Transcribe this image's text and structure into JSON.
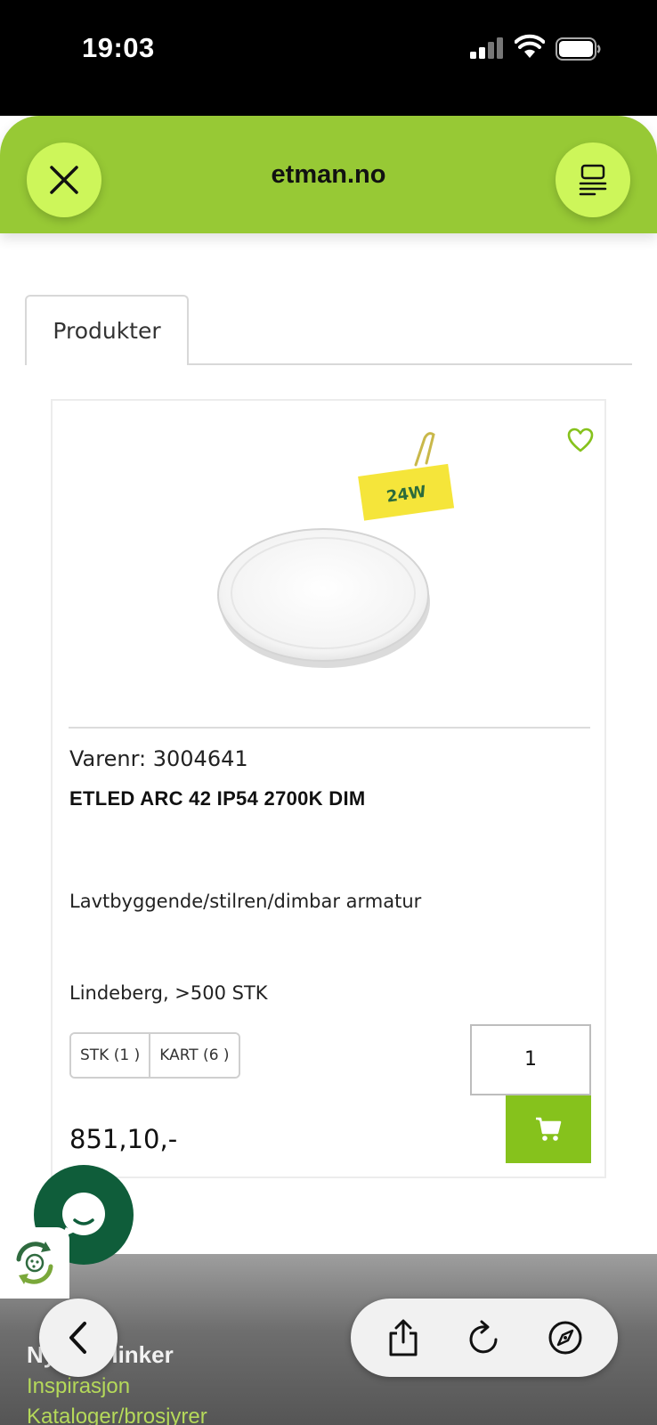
{
  "status_bar": {
    "time": "19:03"
  },
  "header": {
    "site_title": "etman.no",
    "close_icon": "close-icon",
    "menu_icon": "menu-icon",
    "accent_color": "#97c935"
  },
  "tabs": [
    {
      "label": "Produkter"
    }
  ],
  "product": {
    "badge": "24W",
    "varenr": "Varenr: 3004641",
    "name": "ETLED ARC 42 IP54 2700K DIM",
    "description": "Lavtbyggende/stilren/dimbar armatur",
    "stock": "Lindeberg, >500 STK",
    "units": [
      {
        "label": "STK (1 )"
      },
      {
        "label": "KART (6 )"
      }
    ],
    "quantity": "1",
    "price": "851,10,-"
  },
  "footer": {
    "title": "Nyttige linker",
    "links": [
      "Inspirasjon",
      "Kataloger/brosjyrer"
    ]
  },
  "browser_toolbar": {
    "icons": [
      "back-icon",
      "share-icon",
      "reload-icon",
      "compass-icon"
    ]
  }
}
